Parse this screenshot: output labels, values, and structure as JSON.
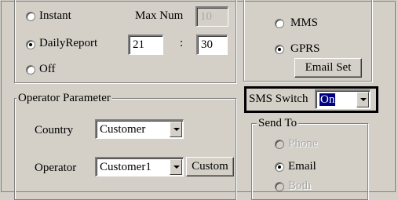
{
  "mode": {
    "instant_label": "Instant",
    "max_num_label": "Max Num",
    "max_num_value": "10",
    "dailyreport_label": "DailyReport",
    "hour_value": "21",
    "colon": ":",
    "minute_value": "30",
    "off_label": "Off",
    "selected": "DailyReport"
  },
  "transport": {
    "mms_label": "MMS",
    "gprs_label": "GPRS",
    "selected": "GPRS",
    "email_set_label": "Email Set"
  },
  "operator": {
    "group_title": "Operator Parameter",
    "country_label": "Country",
    "country_value": "Customer",
    "operator_label": "Operator",
    "operator_value": "Customer1",
    "custom_label": "Custom"
  },
  "sms": {
    "switch_label": "SMS Switch",
    "switch_value": "On"
  },
  "send_to": {
    "group_title": "Send To",
    "phone_label": "Phone",
    "email_label": "Email",
    "both_label": "Both",
    "selected": "Email"
  }
}
